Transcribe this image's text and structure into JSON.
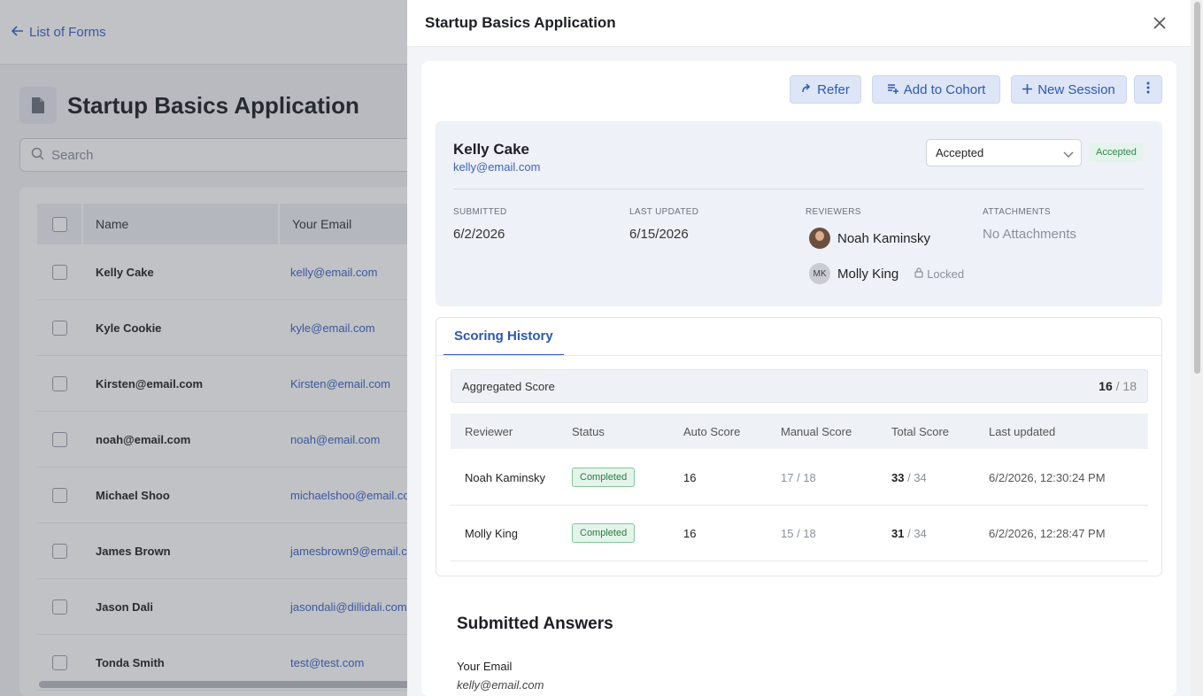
{
  "background": {
    "back_link": "List of Forms",
    "page_title": "Startup Basics Application",
    "search_placeholder": "Search",
    "table": {
      "headers": {
        "name": "Name",
        "email": "Your Email"
      },
      "rows": [
        {
          "name": "Kelly Cake",
          "email": "kelly@email.com"
        },
        {
          "name": "Kyle Cookie",
          "email": "kyle@email.com"
        },
        {
          "name": "Kirsten@email.com",
          "email": "Kirsten@email.com"
        },
        {
          "name": "noah@email.com",
          "email": "noah@email.com"
        },
        {
          "name": "Michael Shoo",
          "email": "michaelshoo@email.com"
        },
        {
          "name": "James Brown",
          "email": "jamesbrown9@email.com"
        },
        {
          "name": "Jason Dali",
          "email": "jasondali@dillidali.com"
        },
        {
          "name": "Tonda Smith",
          "email": "test@test.com"
        }
      ]
    }
  },
  "drawer": {
    "title": "Startup Basics Application",
    "actions": {
      "refer": "Refer",
      "add_to_cohort": "Add to Cohort",
      "new_session": "New Session"
    },
    "applicant": {
      "name": "Kelly Cake",
      "email": "kelly@email.com",
      "status_select": "Accepted",
      "status_badge": "Accepted",
      "submitted_label": "SUBMITTED",
      "submitted_value": "6/2/2026",
      "last_updated_label": "LAST UPDATED",
      "last_updated_value": "6/15/2026",
      "reviewers_label": "REVIEWERS",
      "reviewers": [
        {
          "name": "Noah Kaminsky",
          "initials": ""
        },
        {
          "name": "Molly King",
          "initials": "MK",
          "locked": "Locked"
        }
      ],
      "attachments_label": "ATTACHMENTS",
      "attachments_value": "No Attachments"
    },
    "scoring": {
      "tab": "Scoring History",
      "aggregated_label": "Aggregated Score",
      "aggregated_score": "16",
      "aggregated_max": "/ 18",
      "headers": {
        "reviewer": "Reviewer",
        "status": "Status",
        "auto": "Auto Score",
        "manual": "Manual Score",
        "total": "Total Score",
        "updated": "Last updated"
      },
      "rows": [
        {
          "reviewer": "Noah Kaminsky",
          "status": "Completed",
          "auto": "16",
          "manual": "17",
          "manual_max": "/ 18",
          "total": "33",
          "total_max": "/ 34",
          "updated": "6/2/2026, 12:30:24 PM"
        },
        {
          "reviewer": "Molly King",
          "status": "Completed",
          "auto": "16",
          "manual": "15",
          "manual_max": "/ 18",
          "total": "31",
          "total_max": "/ 34",
          "updated": "6/2/2026, 12:28:47 PM"
        }
      ]
    },
    "answers": {
      "title": "Submitted Answers",
      "field_label": "Your Email",
      "field_value": "kelly@email.com"
    }
  },
  "colors": {
    "accent": "#2f57b8",
    "success": "#2a8a4f"
  }
}
